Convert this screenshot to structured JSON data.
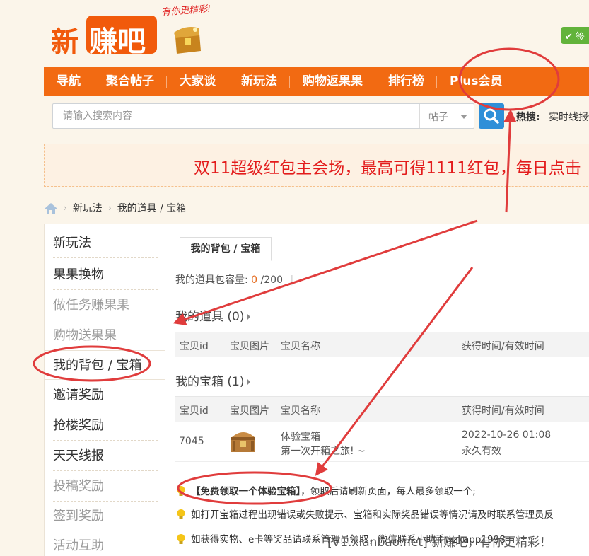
{
  "header": {
    "logo_text_1": "新",
    "logo_text_2": "赚吧",
    "slogan": "有你更精彩!",
    "signin_label": "签"
  },
  "nav": {
    "items": [
      "导航",
      "聚合帖子",
      "大家谈",
      "新玩法",
      "购物返果果",
      "排行榜",
      "Plus会员"
    ]
  },
  "search": {
    "placeholder": "请输入搜索内容",
    "type_selected": "帖子",
    "hot_label": "热搜:",
    "hot_link": "实时线报供"
  },
  "banner": {
    "text": "双11超级红包主会场，最高可得1111红包，每日点击"
  },
  "breadcrumb": {
    "items": [
      "新玩法",
      "我的道具 / 宝箱"
    ]
  },
  "sidebar": {
    "items": [
      {
        "label": "新玩法",
        "style": "head"
      },
      {
        "label": "果果换物",
        "style": "normal"
      },
      {
        "label": "做任务赚果果",
        "style": "dim"
      },
      {
        "label": "购物送果果",
        "style": "dim"
      },
      {
        "label": "我的背包 / 宝箱",
        "style": "active"
      },
      {
        "label": "邀请奖励",
        "style": "normal"
      },
      {
        "label": "抢楼奖励",
        "style": "normal"
      },
      {
        "label": "天天线报",
        "style": "normal"
      },
      {
        "label": "投稿奖励",
        "style": "dim"
      },
      {
        "label": "签到奖励",
        "style": "dim"
      },
      {
        "label": "活动互助",
        "style": "dim"
      }
    ]
  },
  "main": {
    "tab_label": "我的背包 / 宝箱",
    "capacity_label": "我的道具包容量:",
    "capacity_used": "0",
    "capacity_total": "/200",
    "props_title": "我的道具 (0)",
    "boxes_title": "我的宝箱 (1)",
    "columns": [
      "宝贝id",
      "宝贝图片",
      "宝贝名称",
      "获得时间/有效时间"
    ],
    "box_row": {
      "id": "7045",
      "name": "体验宝箱",
      "desc": "第一次开箱之旅! ~",
      "time": "2022-10-26 01:08",
      "validity": "永久有效"
    },
    "tips": [
      {
        "link": "【免费领取一个体验宝箱】",
        "text": "，领取后请刷新页面，每人最多领取一个;"
      },
      {
        "link": "",
        "text": "如打开宝箱过程出现错误或失败提示、宝箱和实际奖品错误等情况请及时联系管理员反"
      },
      {
        "link": "",
        "text": "如获得实物、e卡等奖品请联系管理员领取，微信联系小助手wzkapp1998"
      }
    ]
  },
  "watermark": "[V1.xianbao.net] 新赚吧，有你更精彩！",
  "colors": {
    "accent": "#f26a12",
    "annotation_red": "#e03c3c",
    "search_button": "#2f8fd8"
  }
}
